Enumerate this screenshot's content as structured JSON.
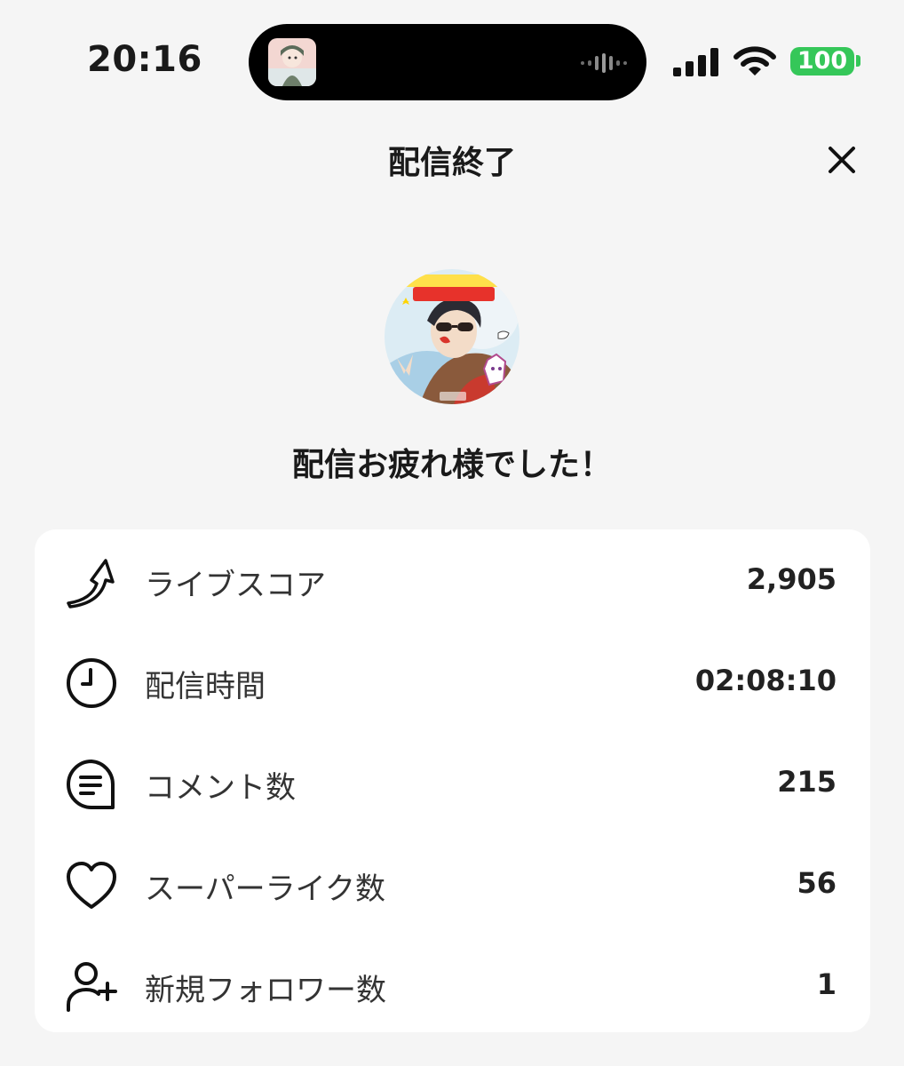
{
  "status_bar": {
    "time": "20:16",
    "battery": "100",
    "icons": [
      "now-playing-thumbnail",
      "audio-wave-icon",
      "cellular-signal-icon",
      "wifi-icon",
      "battery-icon"
    ]
  },
  "header": {
    "title": "配信終了",
    "close_icon": "close-icon"
  },
  "profile": {
    "avatar_icon": "streamer-avatar",
    "greeting": "配信お疲れ様でした！"
  },
  "stats": [
    {
      "icon": "score-arrow-icon",
      "label": "ライブスコア",
      "value": "2,905"
    },
    {
      "icon": "clock-icon",
      "label": "配信時間",
      "value": "02:08:10"
    },
    {
      "icon": "comment-icon",
      "label": "コメント数",
      "value": "215"
    },
    {
      "icon": "heart-icon",
      "label": "スーパーライク数",
      "value": "56"
    },
    {
      "icon": "add-user-icon",
      "label": "新規フォロワー数",
      "value": "1"
    }
  ],
  "colors": {
    "background": "#f5f5f5",
    "card": "#ffffff",
    "battery": "#35c759",
    "text": "#1a1a1a"
  }
}
